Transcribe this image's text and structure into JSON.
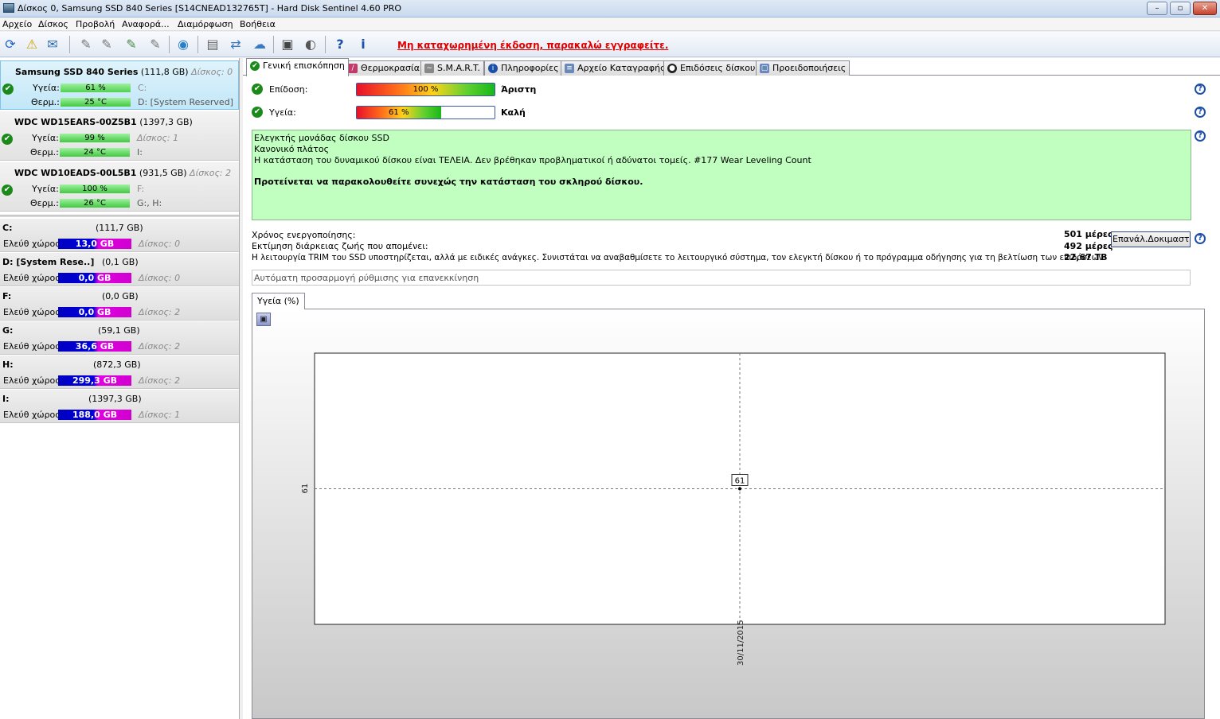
{
  "window": {
    "title": "Δίσκος 0, Samsung SSD 840 Series [S14CNEAD132765T]  -  Hard Disk Sentinel 4.60 PRO",
    "minimize": "–",
    "restore": "▫",
    "close": "✕"
  },
  "menu": [
    "Αρχείο",
    "Δίσκος",
    "Προβολή",
    "Αναφορά...",
    "Διαμόρφωση",
    "Βοήθεια"
  ],
  "toolbar": {
    "notice": "Μη καταχωρημένη έκδοση, παρακαλώ εγγραφείτε."
  },
  "disks": [
    {
      "name": "Samsung SSD 840 Series",
      "size": "(111,8 GB)",
      "disk_label": "Δίσκος: 0",
      "health_label": "Υγεία:",
      "health": "61 %",
      "health_value": 61,
      "temp_label": "Θερμ.:",
      "temp": "25 °C",
      "vol1": "C:",
      "vol2": "D: [System Reserved]",
      "vol1_grey": true
    },
    {
      "name": "WDC WD15EARS-00Z5B1",
      "size": "(1397,3 GB)",
      "disk_label": "",
      "health_label": "Υγεία:",
      "health": "99 %",
      "health_value": 99,
      "temp_label": "Θερμ.:",
      "temp": "24 °C",
      "vol1": "Δίσκος: 1",
      "vol2": "I:"
    },
    {
      "name": "WDC WD10EADS-00L5B1",
      "size": "(931,5 GB)",
      "disk_label": "Δίσκος: 2",
      "health_label": "Υγεία:",
      "health": "100 %",
      "health_value": 100,
      "temp_label": "Θερμ.:",
      "temp": "26 °C",
      "vol1": "F:",
      "vol2": "G:, H:"
    }
  ],
  "volumes": [
    {
      "letter": "C:",
      "size": "(111,7 GB)",
      "free_label": "Ελεύθ χώρος",
      "free": "13,0 GB",
      "disk": "Δίσκος: 0"
    },
    {
      "letter": "D: [System Rese..]",
      "size": "(0,1 GB)",
      "free_label": "Ελεύθ χώρος",
      "free": "0,0 GB",
      "disk": "Δίσκος: 0"
    },
    {
      "letter": "F:",
      "size": "(0,0 GB)",
      "free_label": "Ελεύθ χώρος",
      "free": "0,0 GB",
      "disk": "Δίσκος: 2"
    },
    {
      "letter": "G:",
      "size": "(59,1 GB)",
      "free_label": "Ελεύθ χώρος",
      "free": "36,6 GB",
      "disk": "Δίσκος: 2"
    },
    {
      "letter": "H:",
      "size": "(872,3 GB)",
      "free_label": "Ελεύθ χώρος",
      "free": "299,3 GB",
      "disk": "Δίσκος: 2"
    },
    {
      "letter": "I:",
      "size": "(1397,3 GB)",
      "free_label": "Ελεύθ χώρος",
      "free": "188,0 GB",
      "disk": "Δίσκος: 1"
    }
  ],
  "tabs": [
    {
      "label": "Γενική επισκόπηση",
      "icon": "check-icon",
      "active": true
    },
    {
      "label": "Θερμοκρασία",
      "icon": "thermometer-icon"
    },
    {
      "label": "S.M.A.R.T.",
      "icon": "smart-icon"
    },
    {
      "label": "Πληροφορίες",
      "icon": "info-icon"
    },
    {
      "label": "Αρχείο Καταγραφής",
      "icon": "log-icon"
    },
    {
      "label": "Επιδόσεις δίσκου",
      "icon": "performance-icon"
    },
    {
      "label": "Προειδοποιήσεις",
      "icon": "alerts-icon"
    }
  ],
  "overview": {
    "performance_label": "Επίδοση:",
    "performance_value": "100 %",
    "performance_pct": 100,
    "performance_text": "Άριστη",
    "health_label": "Υγεία:",
    "health_value": "61 %",
    "health_pct": 61,
    "health_text": "Καλή",
    "status_lines": [
      "Ελεγκτής μονάδας δίσκου SSD",
      "Κανονικό πλάτος",
      "Η κατάσταση του δυναμικού δίσκου είναι ΤΕΛΕΙΑ. Δεν βρέθηκαν προβληματικοί ή αδύνατοι τομείς. #177 Wear Leveling Count"
    ],
    "recommendation": "Προτείνεται να παρακολουθείτε συνεχώς την κατάσταση του σκληρού δίσκου.",
    "power_on_label": "Χρόνος ενεργοποίησης:",
    "power_on_value": "501 μέρες,",
    "lifetime_label": "Εκτίμηση διάρκειας ζωής που απομένει:",
    "lifetime_value": "492 μέρες",
    "trim_text": "Η λειτουργία TRIM του SSD υποστηρίζεται, αλλά με ειδικές ανάγκες. Συνιστάται να αναβαθμίσετε το λειτουργικό σύστημα, τον ελεγκτή δίσκου ή το πρόγραμμα οδήγησης για τη βελτίωση των επιδόσεων.",
    "written_value": "22,67 TB",
    "test_button": "Επανάλ.Δοκιμαστ.Τεστ",
    "auto_adjust_placeholder": "Αυτόματη προσαρμογή ρύθμισης για επανεκκίνηση",
    "chart_tab": "Υγεία (%)",
    "save_icon": "floppy-disk-icon"
  },
  "chart_data": {
    "type": "line",
    "x": [
      "30/11/2015"
    ],
    "series": [
      {
        "values": [
          61
        ]
      }
    ],
    "y_tick_labels": [
      "61"
    ],
    "x_tick_labels": [
      "30/11/2015"
    ],
    "data_labels": [
      "61"
    ],
    "grid": true,
    "title": "",
    "xlabel": "",
    "ylabel": ""
  },
  "colors": {
    "accent": "#1c4fa8",
    "ok_green": "#1b8a1b",
    "status_bg": "#c0ffc0",
    "notice_red": "#e00000",
    "free_bar_blue": "#0000c0",
    "free_bar_magenta": "#e000e0"
  }
}
